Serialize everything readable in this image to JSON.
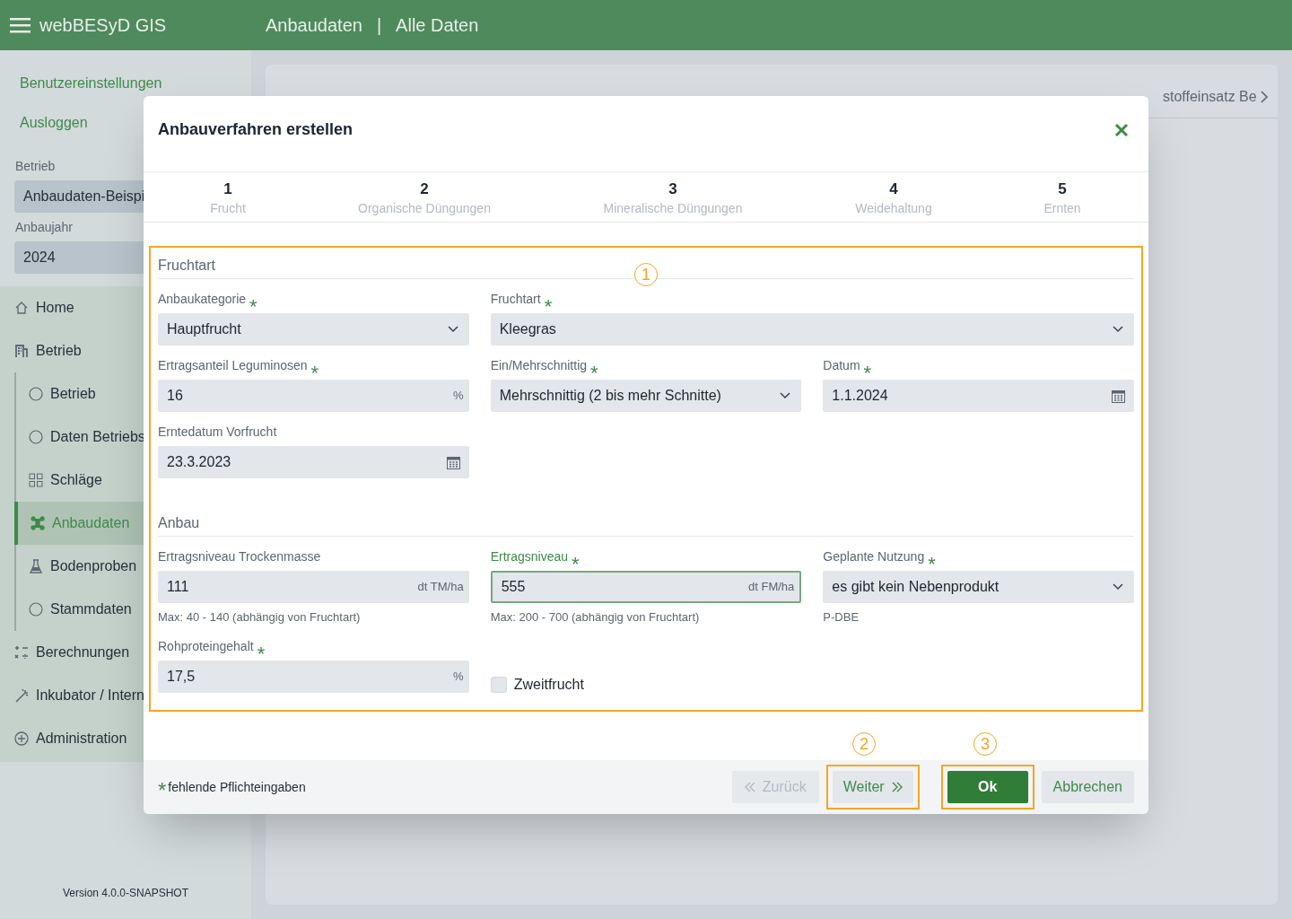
{
  "app": {
    "title": "webBESyD GIS",
    "breadcrumb": [
      "Anbaudaten",
      "Alle Daten"
    ],
    "breadcrumb_separator": "|"
  },
  "sidebar": {
    "links": [
      "Benutzereinstellungen",
      "Ausloggen"
    ],
    "selects": [
      {
        "label": "Betrieb",
        "value": "Anbaudaten-Beispi"
      },
      {
        "label": "Anbaujahr",
        "value": "2024"
      }
    ],
    "nav": [
      {
        "label": "Home",
        "selected": false
      },
      {
        "label": "Betrieb",
        "selected": false,
        "children": [
          {
            "label": "Betrieb",
            "selected": false
          },
          {
            "label": "Daten Betriebs",
            "selected": false
          },
          {
            "label": "Schläge",
            "selected": false
          },
          {
            "label": "Anbaudaten",
            "selected": true
          },
          {
            "label": "Bodenproben",
            "selected": false
          },
          {
            "label": "Stammdaten",
            "selected": false
          }
        ]
      },
      {
        "label": "Berechnungen",
        "selected": false
      },
      {
        "label": "Inkubator / Intern",
        "selected": false
      },
      {
        "label": "Administration",
        "selected": false
      }
    ],
    "version": "Version 4.0.0-SNAPSHOT"
  },
  "panel": {
    "tabs": [
      {
        "label": "stoffeinsatz Be",
        "selected": false
      }
    ]
  },
  "dialog": {
    "title": "Anbauverfahren erstellen",
    "steps": [
      {
        "number": "1",
        "label": "Frucht"
      },
      {
        "number": "2",
        "label": "Organische Düngungen"
      },
      {
        "number": "3",
        "label": "Mineralische Düngungen"
      },
      {
        "number": "4",
        "label": "Weidehaltung"
      },
      {
        "number": "5",
        "label": "Ernten"
      }
    ],
    "sections": [
      {
        "title": "Fruchtart",
        "fields": [
          {
            "kind": "select",
            "label": "Anbaukategorie",
            "required": true,
            "value": "Hauptfrucht"
          },
          {
            "kind": "select",
            "label": "Fruchtart",
            "required": true,
            "value": "Kleegras",
            "wide": true
          },
          {
            "kind": "input",
            "label": "Ertragsanteil Leguminosen",
            "required": true,
            "value": "16",
            "unit": "%"
          },
          {
            "kind": "select",
            "label": "Ein/Mehrschnittig",
            "required": true,
            "value": "Mehrschnittig (2 bis mehr Schnitte)"
          },
          {
            "kind": "date",
            "label": "Datum",
            "required": true,
            "value": "1.1.2024"
          },
          {
            "kind": "date",
            "label": "Erntedatum Vorfrucht",
            "required": false,
            "value": "23.3.2023"
          }
        ]
      },
      {
        "title": "Anbau",
        "fields": [
          {
            "kind": "input",
            "label": "Ertragsniveau Trockenmasse",
            "required": false,
            "value": "111",
            "unit": "dt TM/ha",
            "hint": "Max: 40 - 140 (abhängig von Fruchtart)"
          },
          {
            "kind": "input",
            "label": "Ertragsniveau",
            "required": true,
            "value": "555",
            "unit": "dt FM/ha",
            "hint": "Max: 200 - 700 (abhängig von Fruchtart)",
            "focused": true
          },
          {
            "kind": "select",
            "label": "Geplante Nutzung",
            "required": true,
            "value": "es gibt kein Nebenprodukt",
            "hint": "P-DBE"
          },
          {
            "kind": "input",
            "label": "Rohproteingehalt",
            "required": true,
            "value": "17,5",
            "unit": "%"
          },
          {
            "kind": "checkbox",
            "label": "Zweitfrucht",
            "checked": false
          }
        ]
      }
    ],
    "required_mark": "*",
    "required_note": "fehlende Pflichteingaben",
    "buttons": [
      {
        "kind": "back",
        "label": "Zurück",
        "disabled": true
      },
      {
        "kind": "next",
        "label": "Weiter",
        "disabled": false
      },
      {
        "kind": "ok",
        "label": "Ok",
        "disabled": false
      },
      {
        "kind": "cancel",
        "label": "Abbrechen",
        "disabled": false
      }
    ]
  },
  "callouts": [
    "1",
    "2",
    "3"
  ]
}
